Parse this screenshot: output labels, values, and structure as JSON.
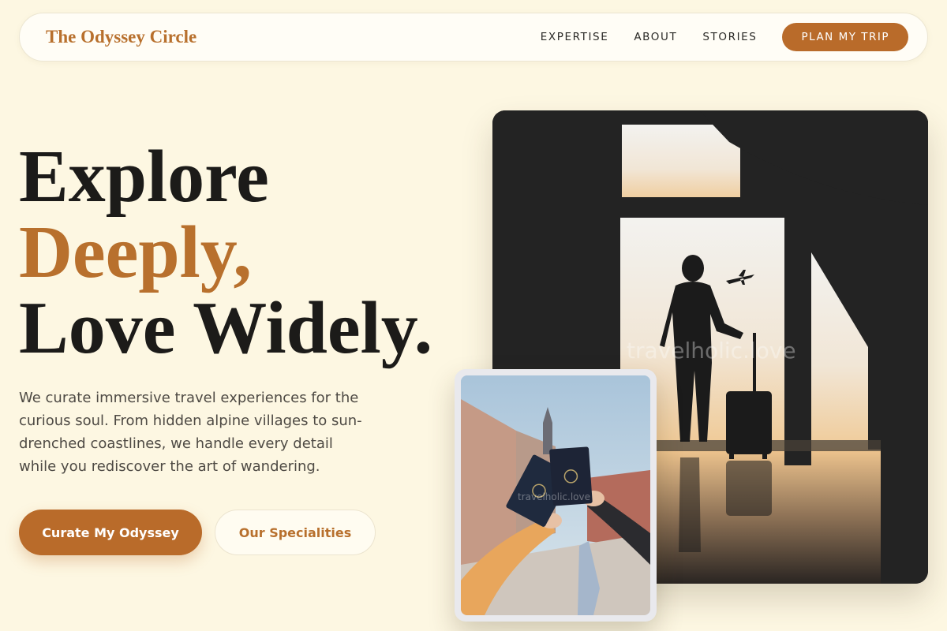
{
  "brand": {
    "name": "The Odyssey Circle",
    "accent": "#b8702d",
    "background": "#fdf7e2"
  },
  "nav": {
    "links": [
      "EXPERTISE",
      "ABOUT",
      "STORIES"
    ],
    "cta": "PLAN MY TRIP"
  },
  "hero": {
    "line1": "Explore",
    "line2": "Deeply,",
    "line3": "Love Widely.",
    "description": "We curate immersive travel experiences for the curious soul. From hidden alpine villages to sun-drenched coastlines, we handle every detail while you rediscover the art of wandering.",
    "primary_cta": "Curate My Odyssey",
    "secondary_cta": "Our Specialities"
  },
  "images": {
    "main": {
      "subject": "silhouette of traveler with suitcase at airport window, plane in sky",
      "watermark": "travelholic.love"
    },
    "inset": {
      "subject": "two hands exchanging passports in a city square",
      "watermark": "travelholic.love"
    }
  }
}
